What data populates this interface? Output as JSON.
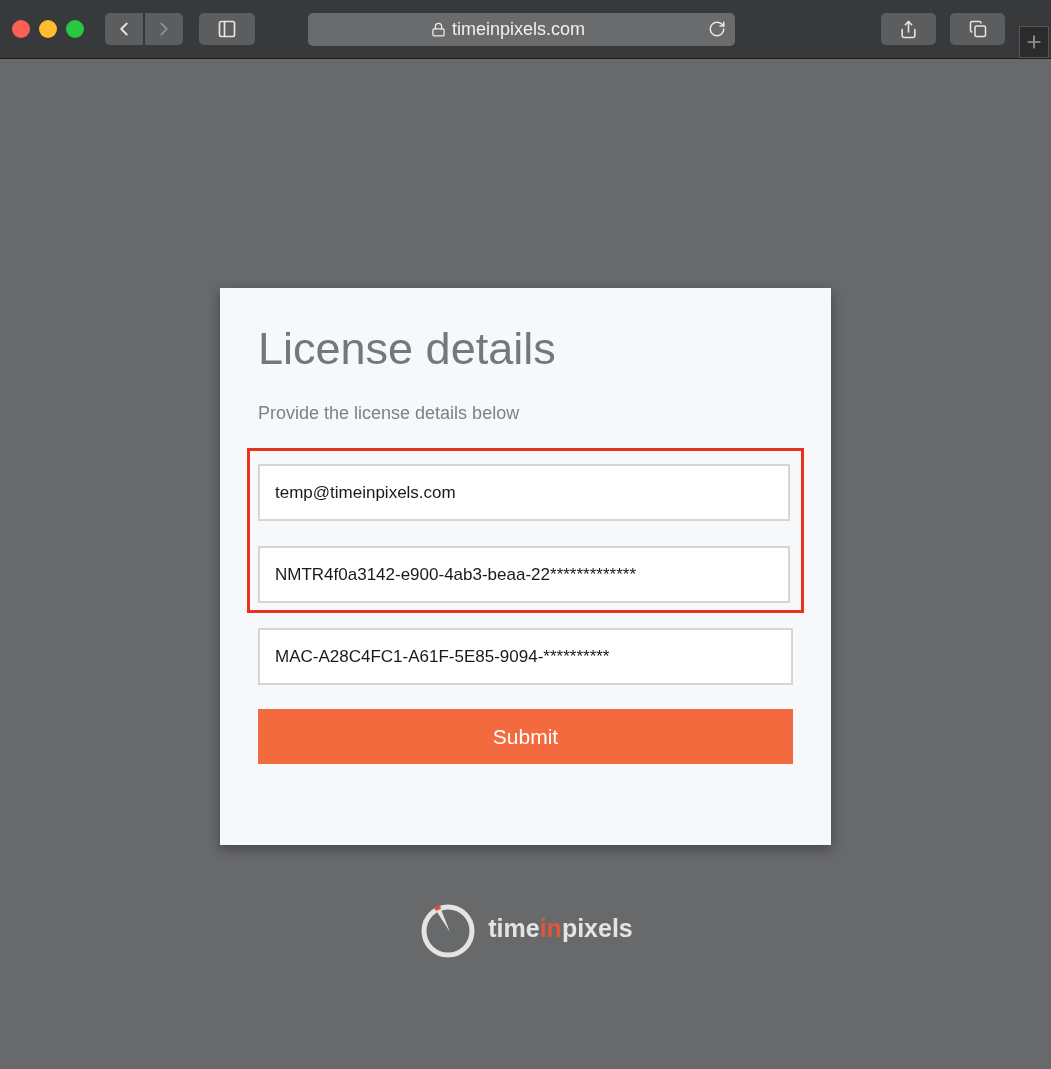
{
  "browser": {
    "url": "timeinpixels.com",
    "back_disabled": false,
    "forward_disabled": true
  },
  "card": {
    "title": "License details",
    "subtitle": "Provide the license details below",
    "fields": [
      {
        "value": "temp@timeinpixels.com",
        "highlighted": true
      },
      {
        "value": "NMTR4f0a3142-e900-4ab3-beaa-22*************",
        "highlighted": true
      },
      {
        "value": "MAC-A28C4FC1-A61F-5E85-9094-**********",
        "highlighted": false
      }
    ],
    "submit": "Submit"
  },
  "logo": {
    "parts": [
      {
        "text": "time",
        "accent": false
      },
      {
        "text": "in",
        "accent": true
      },
      {
        "text": "pixels",
        "accent": false
      }
    ]
  }
}
